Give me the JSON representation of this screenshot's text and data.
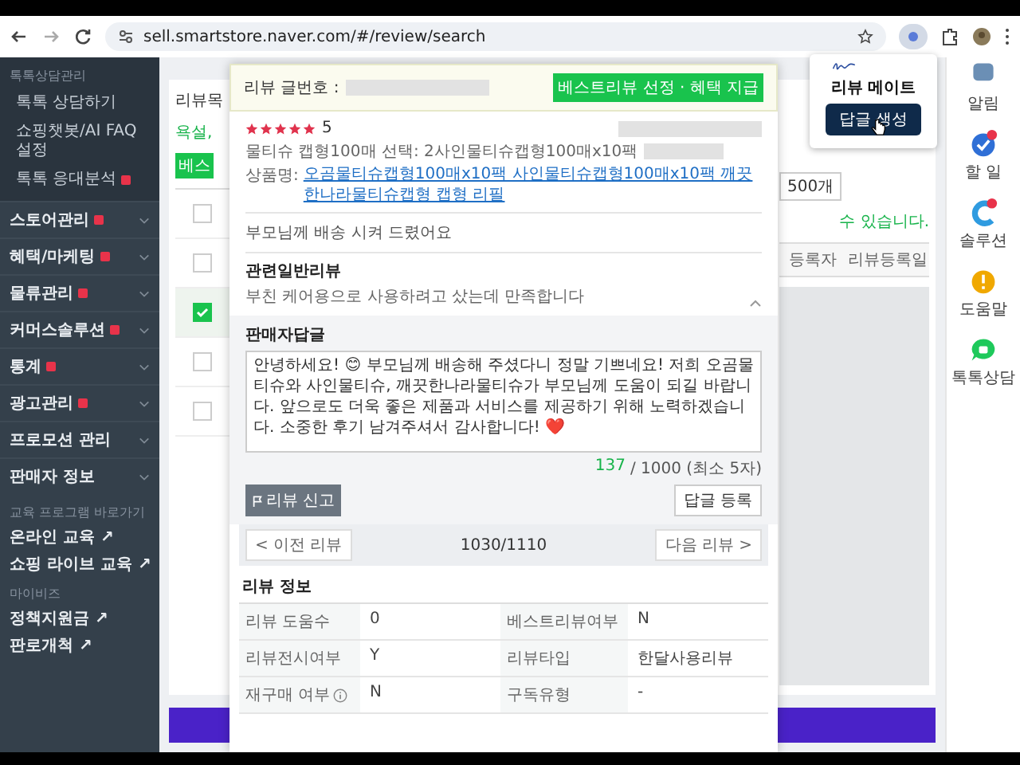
{
  "browser": {
    "url": "sell.smartstore.naver.com/#/review/search"
  },
  "sidebar": {
    "section_title": "톡톡상담관리",
    "sub_items": [
      {
        "label": "톡톡 상담하기",
        "new": false
      },
      {
        "label": "쇼핑챗봇/AI FAQ 설정",
        "new": false
      },
      {
        "label": "톡톡 응대분석",
        "new": true
      }
    ],
    "menus": [
      {
        "label": "스토어관리",
        "new": true
      },
      {
        "label": "혜택/마케팅",
        "new": true
      },
      {
        "label": "물류관리",
        "new": true
      },
      {
        "label": "커머스솔루션",
        "new": true
      },
      {
        "label": "통계",
        "new": true
      },
      {
        "label": "광고관리",
        "new": true
      },
      {
        "label": "프로모션 관리",
        "new": false
      },
      {
        "label": "판매자 정보",
        "new": false
      }
    ],
    "link_groups": [
      {
        "title": "교육 프로그램 바로가기",
        "links": [
          "온라인 교육 ↗",
          "쇼핑 라이브 교육 ↗"
        ]
      },
      {
        "title": "마이비즈",
        "links": [
          "정책지원금 ↗",
          "판로개척 ↗"
        ]
      }
    ]
  },
  "background_page": {
    "title": "리뷰목",
    "notice_left": "욕설,",
    "button": "베스",
    "page_size": "500개",
    "notice_right": "수 있습니다.",
    "columns": [
      "등록자",
      "리뷰등록일"
    ],
    "rows": [
      {
        "checked": false
      },
      {
        "checked": false
      },
      {
        "checked": true
      },
      {
        "checked": false
      },
      {
        "checked": false
      }
    ]
  },
  "review_modal": {
    "number_label": "리뷰 글번호 :",
    "best_button": "베스트리뷰 선정 · 혜택 지급",
    "stars": 5,
    "rating": "5",
    "option": "물티슈 캡형100매 선택: 2사인물티슈캡형100매x10팩",
    "product_label": "상품명:",
    "product_link": "오곰물티슈캡형100매x10팩 사인물티슈캡형100매x10팩 깨끗한나라물티슈캡형 캡형 리필",
    "content": "부모님께 배송 시켜 드렸어요",
    "related": {
      "title": "관련일반리뷰",
      "text": "부친 케어용으로 사용하려고 샀는데 만족합니다",
      "expanded": true
    },
    "reply": {
      "title": "판매자답글",
      "value": "안녕하세요! 😊 부모님께 배송해 주셨다니 정말 기쁘네요! 저희 오곰물티슈와 사인물티슈, 깨끗한나라물티슈가 부모님께 도움이 되길 바랍니다. 앞으로도 더욱 좋은 제품과 서비스를 제공하기 위해 노력하겠습니다. 소중한 후기 남겨주셔서 감사합니다! ❤️",
      "count": "137",
      "limit": "/ 1000 (최소 5자)",
      "report_button": "리뷰 신고",
      "submit_button": "답글 등록"
    },
    "nav": {
      "prev": "< 이전 리뷰",
      "position": "1030/1110",
      "next": "다음 리뷰 >"
    },
    "info": {
      "title": "리뷰 정보",
      "rows": [
        [
          {
            "label": "리뷰 도움수",
            "value": "0",
            "info": false
          },
          {
            "label": "베스트리뷰여부",
            "value": "N",
            "info": false
          }
        ],
        [
          {
            "label": "리뷰전시여부",
            "value": "Y",
            "info": false
          },
          {
            "label": "리뷰타입",
            "value": "한달사용리뷰",
            "info": false
          }
        ],
        [
          {
            "label": "재구매 여부",
            "value": "N",
            "info": true
          },
          {
            "label": "구독유형",
            "value": "-",
            "info": false
          }
        ]
      ]
    }
  },
  "extension_popup": {
    "title": "리뷰 메이트",
    "button": "답글 생성"
  },
  "right_rail": [
    {
      "label": "알림",
      "kind": "alert",
      "badge": false
    },
    {
      "label": "할 일",
      "kind": "todo",
      "badge": true
    },
    {
      "label": "솔루션",
      "kind": "solution",
      "badge": true
    },
    {
      "label": "도움말",
      "kind": "help",
      "badge": false
    },
    {
      "label": "톡톡상담",
      "kind": "talk",
      "badge": false
    }
  ]
}
